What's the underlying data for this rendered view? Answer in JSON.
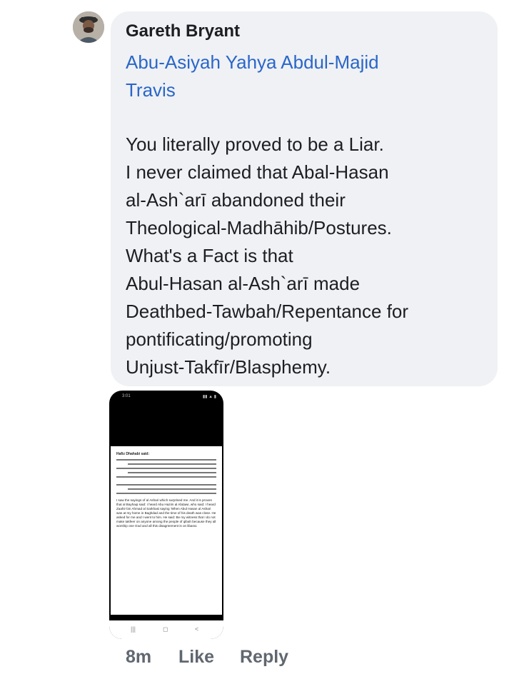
{
  "comment": {
    "author": "Gareth Bryant",
    "mention_line1": "Abu-Asiyah Yahya Abdul-Majid",
    "mention_line2": "Travis",
    "lines": [
      "You literally proved to be a Liar.",
      "I never claimed that Abal-Hasan",
      "al-Ash`arī abandoned their",
      "Theological-Madhāhib/Postures.",
      "What's a Fact is that",
      "Abul-Hasan al-Ash`arī made",
      "Deathbed-Tawbah/Repentance for",
      "pontificating/promoting",
      "Unjust-Takfīr/Blasphemy."
    ]
  },
  "attachment": {
    "status_time": "3:01",
    "page_title": "Hafiz Dhahabi said:",
    "english_text": "I saw the sayings of al Ashari which surprised me. And it is proven that al Bayhaqi said: I heard Abu Hazim al Abdawi, who said: I heard Zaahir bin Ahmad al Sarkhasi saying 'When Abul Hasan al Ashari was at my home in Baghdad and the time of his death was close. He asked for me and I went to him. He said: Be my witness that I do not make takfeer on anyone among the people of qibah because they all worship one God and all this disagreement is on libarat.",
    "nav_icons": [
      "|||",
      "◻",
      "<"
    ]
  },
  "actions": {
    "time": "8m",
    "like": "Like",
    "reply": "Reply"
  },
  "colors": {
    "bubble": "#eff1f4",
    "link": "#2a66c9",
    "text": "#1c1e21",
    "meta": "#606770"
  }
}
